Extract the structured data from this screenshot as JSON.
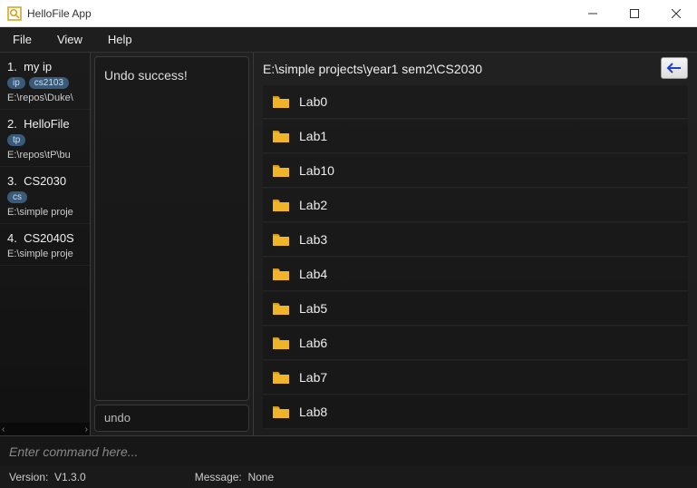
{
  "window": {
    "title": "HelloFile App"
  },
  "menu": {
    "file": "File",
    "view": "View",
    "help": "Help"
  },
  "sidebar": {
    "items": [
      {
        "index": "1.",
        "title": "my ip",
        "tag1": "ip",
        "tag2": "cs2103",
        "path": "E:\\repos\\Duke\\"
      },
      {
        "index": "2.",
        "title": "HelloFile",
        "tag1": "tp",
        "path": "E:\\repos\\tP\\bu"
      },
      {
        "index": "3.",
        "title": "CS2030",
        "tag1": "cs",
        "path": "E:\\simple proje"
      },
      {
        "index": "4.",
        "title": "CS2040S",
        "path": "E:\\simple proje"
      }
    ]
  },
  "mid": {
    "result": "Undo success!",
    "undo": "undo"
  },
  "main": {
    "path": "E:\\simple projects\\year1 sem2\\CS2030",
    "files": [
      "Lab0",
      "Lab1",
      "Lab10",
      "Lab2",
      "Lab3",
      "Lab4",
      "Lab5",
      "Lab6",
      "Lab7",
      "Lab8"
    ]
  },
  "command": {
    "placeholder": "Enter command here..."
  },
  "status": {
    "version_label": "Version:",
    "version": "V1.3.0",
    "message_label": "Message:",
    "message": "None"
  }
}
